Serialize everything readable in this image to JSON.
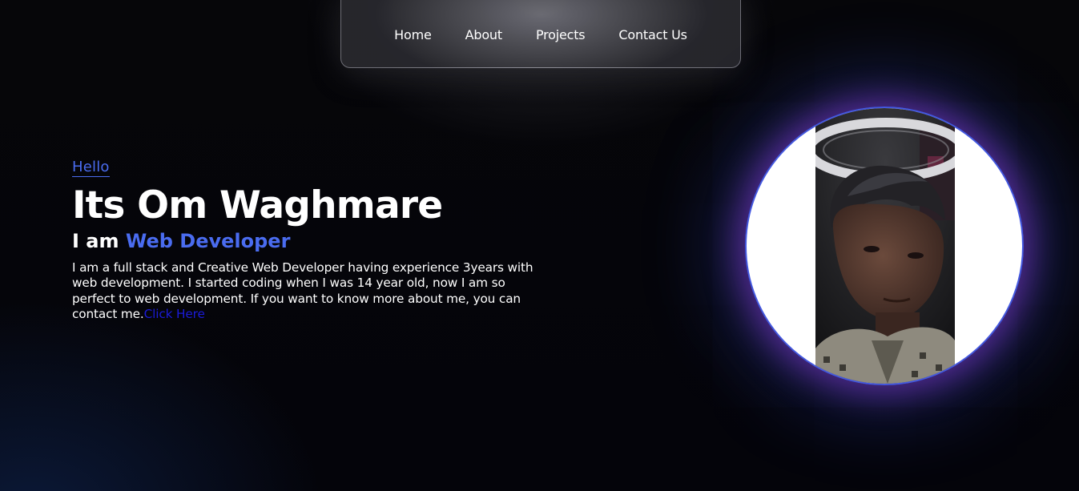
{
  "nav": {
    "items": [
      {
        "label": "Home"
      },
      {
        "label": "About"
      },
      {
        "label": "Projects"
      },
      {
        "label": "Contact Us"
      }
    ]
  },
  "hero": {
    "greeting": "Hello",
    "name": "Its Om Waghmare",
    "role_prefix": "I am ",
    "role_highlight": "Web Developer",
    "bio": "I am a full stack and Creative Web Developer having experience 3years with web development. I started coding when I was 14 year old, now I am so perfect to web development. If you want to know more about me, you can contact me.",
    "bio_link": "Click Here"
  },
  "profile": {
    "icon": "profile-photo"
  },
  "colors": {
    "accent": "#4a6cf0",
    "link": "#1b1bd8",
    "background": "#05050a",
    "glow": "#8c3cdc"
  }
}
